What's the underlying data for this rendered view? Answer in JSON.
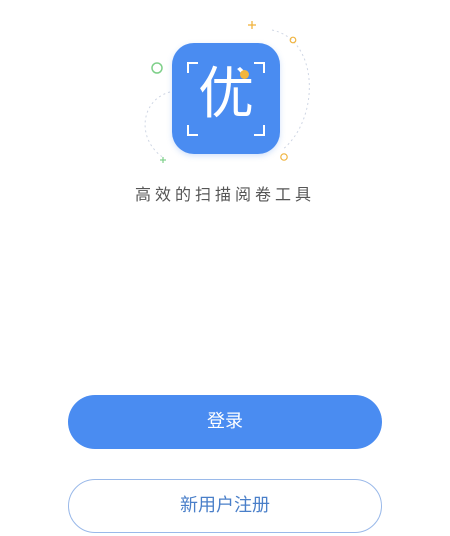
{
  "app": {
    "logo_char": "优",
    "tagline": "高效的扫描阅卷工具"
  },
  "actions": {
    "login_label": "登录",
    "register_label": "新用户注册"
  },
  "colors": {
    "primary": "#4a8cf1",
    "accent_dot": "#f3b63b",
    "register_border": "#9ab9e9",
    "deco_green": "#7fd08a",
    "deco_orange": "#f0b43f"
  },
  "icons": [
    "app-logo-icon",
    "sparkle-plus-icon",
    "ring-icon"
  ]
}
